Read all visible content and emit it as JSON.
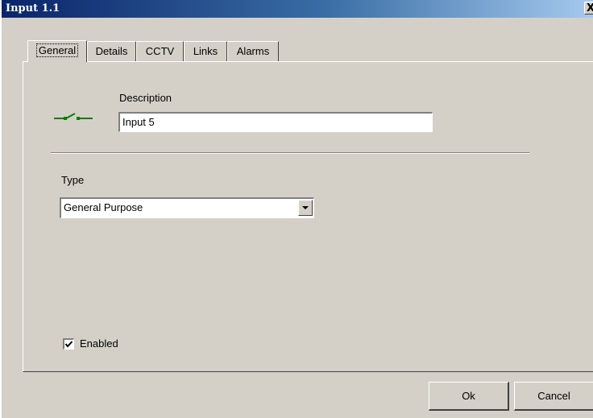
{
  "window": {
    "title": "Input 1.1",
    "close_glyph": "X"
  },
  "tabs": [
    {
      "label": "General",
      "active": true
    },
    {
      "label": "Details",
      "active": false
    },
    {
      "label": "CCTV",
      "active": false
    },
    {
      "label": "Links",
      "active": false
    },
    {
      "label": "Alarms",
      "active": false
    }
  ],
  "general": {
    "icon": "switch-icon",
    "icon_color": "#008000",
    "description_label": "Description",
    "description_value": "Input 5",
    "type_label": "Type",
    "type_value": "General Purpose",
    "enabled_label": "Enabled",
    "enabled_checked": true
  },
  "buttons": {
    "ok_label": "Ok",
    "cancel_label": "Cancel"
  }
}
